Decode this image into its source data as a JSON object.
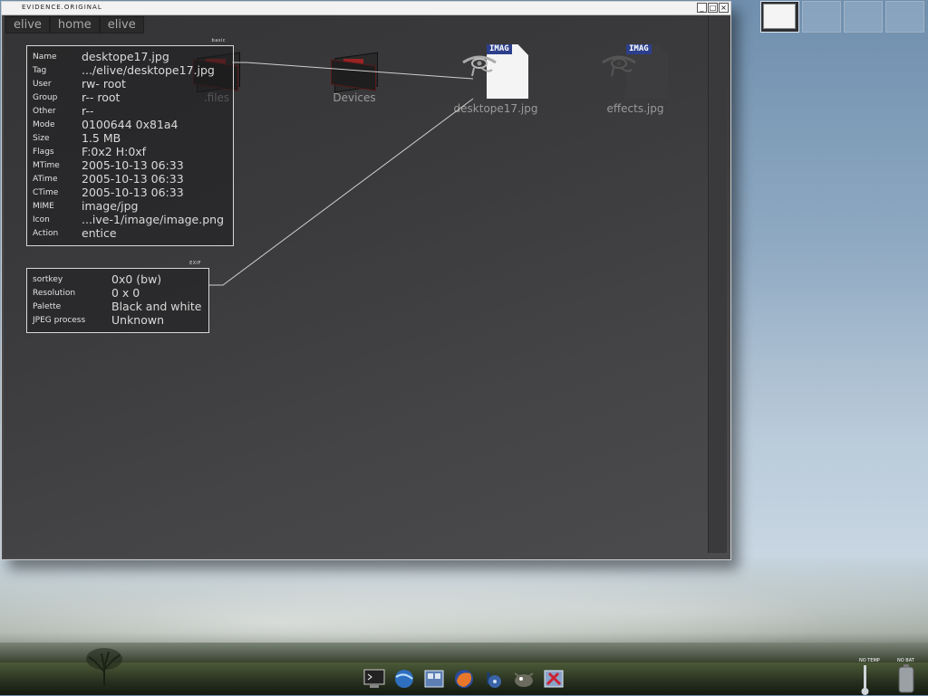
{
  "window": {
    "title": "EVIDENCE.ORIGINAL",
    "buttons": [
      "_",
      "□",
      "×"
    ]
  },
  "breadcrumb": [
    "elive",
    "home",
    "elive"
  ],
  "files": [
    {
      "label": ".files",
      "type": "folder"
    },
    {
      "label": "Devices",
      "type": "folder"
    },
    {
      "label": "desktope17.jpg",
      "type": "image",
      "badge": "IMAG",
      "selected": true
    },
    {
      "label": "effects.jpg",
      "type": "image",
      "badge": "IMAG",
      "selected": false
    }
  ],
  "basic_panel": {
    "title": "basic",
    "rows": [
      {
        "key": "Name",
        "value": "desktope17.jpg"
      },
      {
        "key": "Tag",
        "value": ".../elive/desktope17.jpg"
      },
      {
        "key": "User",
        "value": "rw- root"
      },
      {
        "key": "Group",
        "value": "r-- root"
      },
      {
        "key": "Other",
        "value": "r--"
      },
      {
        "key": "Mode",
        "value": "0100644 0x81a4"
      },
      {
        "key": "Size",
        "value": "1.5 MB"
      },
      {
        "key": "Flags",
        "value": "F:0x2 H:0xf"
      },
      {
        "key": "MTime",
        "value": "2005-10-13 06:33"
      },
      {
        "key": "ATime",
        "value": "2005-10-13 06:33"
      },
      {
        "key": "CTime",
        "value": "2005-10-13 06:33"
      },
      {
        "key": "MIME",
        "value": "image/jpg"
      },
      {
        "key": "Icon",
        "value": "...ive-1/image/image.png"
      },
      {
        "key": "Action",
        "value": "entice"
      }
    ]
  },
  "exif_panel": {
    "title": "EXIF",
    "rows": [
      {
        "key": "sortkey",
        "value": "0x0 (bw)"
      },
      {
        "key": "Resolution",
        "value": "0 x 0"
      },
      {
        "key": "Palette",
        "value": "Black and white"
      },
      {
        "key": "JPEG process",
        "value": "Unknown"
      }
    ]
  },
  "gadgets": {
    "temp_label": "NO TEMP",
    "battery_label": "NO BAT"
  },
  "colors": {
    "window_bg": "#444446",
    "panel_border": "#d8d8d8",
    "badge_blue": "#2c3f8c"
  },
  "dock_icons": [
    "terminal-icon",
    "network-icon",
    "file-manager-icon",
    "firefox-icon",
    "audio-icon",
    "gimp-icon",
    "tools-icon"
  ]
}
